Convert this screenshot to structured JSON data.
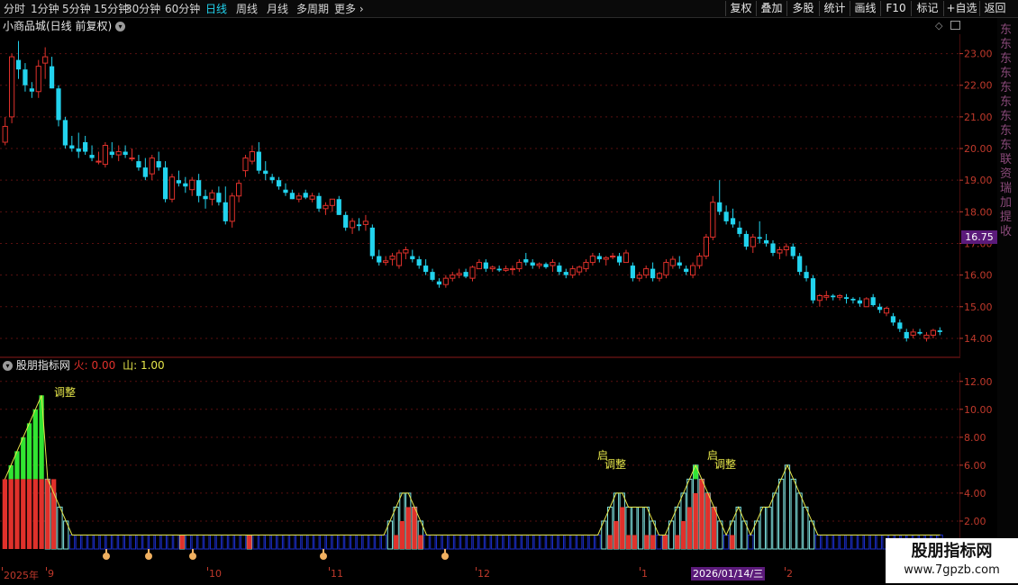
{
  "toolbar": {
    "periods": [
      "分时",
      "1分钟",
      "5分钟",
      "15分钟",
      "30分钟",
      "60分钟",
      "日线",
      "周线",
      "月线",
      "多周期",
      "更多"
    ],
    "active_period": "日线",
    "tools": [
      "复权",
      "叠加",
      "多股",
      "统计",
      "画线",
      "F10",
      "标记",
      "+自选",
      "返回"
    ]
  },
  "main_panel": {
    "title": "小商品城(日线 前复权)",
    "price_ticks": [
      "23.00",
      "22.00",
      "21.00",
      "20.00",
      "19.00",
      "18.00",
      "17.00",
      "16.00",
      "15.00",
      "14.00"
    ],
    "current_price_tag": "16.75"
  },
  "indicator_panel": {
    "name": "股朋指标网",
    "fire_label": "火:",
    "fire_value": "0.00",
    "mountain_label": "山:",
    "mountain_value": "1.00",
    "ticks": [
      "12.00",
      "10.00",
      "8.00",
      "6.00",
      "4.00",
      "2.00"
    ],
    "annotations": {
      "adjust": "调整",
      "start": "启"
    }
  },
  "date_axis": {
    "labels": [
      "2025年",
      "9",
      "10",
      "11",
      "12",
      "1",
      "2"
    ],
    "selected_date": "2026/01/14/三"
  },
  "watermark": {
    "title": "股朋指标网",
    "url": "www.7gpzb.com"
  },
  "side_strip_text": "东东东东东东东东东联资瑞加提收",
  "colors": {
    "up": "#e0312b",
    "down": "#22d3ee",
    "green": "#32e532",
    "accent": "#22d3ee",
    "axis": "#c0392b",
    "blue_bar": "#1c2fd0"
  },
  "chart_data": [
    {
      "type": "candlestick",
      "title": "小商品城(日线 前复权)",
      "ylim": [
        13.6,
        23.5
      ],
      "candles": [
        [
          20.2,
          21.0,
          20.1,
          20.7
        ],
        [
          21.0,
          23.0,
          20.8,
          22.9
        ],
        [
          22.8,
          23.4,
          22.2,
          22.5
        ],
        [
          22.5,
          22.7,
          21.8,
          22.0
        ],
        [
          21.9,
          22.1,
          21.6,
          21.8
        ],
        [
          21.8,
          22.8,
          21.6,
          22.6
        ],
        [
          22.7,
          23.2,
          22.2,
          22.9
        ],
        [
          22.6,
          22.9,
          21.9,
          21.9
        ],
        [
          21.9,
          22.0,
          20.7,
          20.9
        ],
        [
          20.9,
          21.0,
          20.0,
          20.1
        ],
        [
          20.1,
          20.4,
          19.9,
          20.0
        ],
        [
          20.0,
          20.5,
          19.7,
          19.9
        ],
        [
          20.2,
          20.4,
          19.8,
          19.9
        ],
        [
          19.8,
          20.1,
          19.6,
          19.7
        ],
        [
          19.6,
          19.9,
          19.5,
          19.6
        ],
        [
          19.5,
          20.2,
          19.4,
          20.1
        ],
        [
          19.9,
          20.2,
          19.7,
          19.8
        ],
        [
          19.8,
          20.1,
          19.6,
          19.9
        ],
        [
          19.9,
          20.1,
          19.7,
          19.8
        ],
        [
          19.7,
          20.0,
          19.6,
          19.7
        ],
        [
          19.6,
          19.8,
          19.3,
          19.4
        ],
        [
          19.4,
          19.7,
          19.0,
          19.1
        ],
        [
          19.2,
          19.8,
          19.0,
          19.7
        ],
        [
          19.6,
          19.9,
          19.3,
          19.4
        ],
        [
          19.4,
          19.6,
          18.3,
          18.4
        ],
        [
          18.4,
          19.2,
          18.3,
          19.1
        ],
        [
          19.0,
          19.3,
          18.8,
          18.9
        ],
        [
          18.9,
          19.1,
          18.6,
          18.8
        ],
        [
          18.7,
          19.1,
          18.5,
          19.0
        ],
        [
          19.0,
          19.2,
          18.3,
          18.5
        ],
        [
          18.5,
          18.7,
          18.1,
          18.4
        ],
        [
          18.4,
          18.7,
          18.2,
          18.6
        ],
        [
          18.6,
          18.8,
          18.2,
          18.3
        ],
        [
          18.3,
          18.8,
          17.6,
          17.7
        ],
        [
          17.7,
          18.6,
          17.5,
          18.5
        ],
        [
          18.5,
          19.0,
          18.3,
          18.9
        ],
        [
          19.3,
          19.8,
          19.1,
          19.7
        ],
        [
          19.6,
          20.1,
          19.5,
          19.9
        ],
        [
          19.9,
          20.2,
          19.2,
          19.3
        ],
        [
          19.3,
          19.6,
          19.0,
          19.2
        ],
        [
          19.1,
          19.2,
          18.9,
          19.0
        ],
        [
          19.0,
          19.1,
          18.7,
          18.8
        ],
        [
          18.7,
          18.9,
          18.5,
          18.6
        ],
        [
          18.6,
          18.7,
          18.4,
          18.4
        ],
        [
          18.4,
          18.6,
          18.3,
          18.5
        ],
        [
          18.6,
          18.7,
          18.4,
          18.45
        ],
        [
          18.4,
          18.6,
          18.3,
          18.5
        ],
        [
          18.5,
          18.6,
          18.0,
          18.1
        ],
        [
          18.1,
          18.3,
          17.9,
          18.2
        ],
        [
          18.2,
          18.4,
          18.0,
          18.4
        ],
        [
          18.4,
          18.5,
          17.9,
          17.9
        ],
        [
          17.9,
          18.0,
          17.4,
          17.5
        ],
        [
          17.5,
          17.8,
          17.3,
          17.7
        ],
        [
          17.6,
          17.8,
          17.4,
          17.55
        ],
        [
          17.6,
          17.9,
          17.4,
          17.7
        ],
        [
          17.5,
          17.6,
          16.5,
          16.6
        ],
        [
          16.6,
          16.8,
          16.3,
          16.4
        ],
        [
          16.4,
          16.6,
          16.3,
          16.45
        ],
        [
          16.5,
          16.7,
          16.3,
          16.6
        ],
        [
          16.3,
          16.8,
          16.2,
          16.7
        ],
        [
          16.7,
          16.9,
          16.5,
          16.8
        ],
        [
          16.6,
          16.8,
          16.4,
          16.5
        ],
        [
          16.5,
          16.6,
          16.2,
          16.3
        ],
        [
          16.3,
          16.5,
          16.0,
          16.1
        ],
        [
          16.1,
          16.2,
          15.8,
          15.85
        ],
        [
          15.8,
          15.9,
          15.6,
          15.7
        ],
        [
          15.7,
          16.0,
          15.6,
          15.9
        ],
        [
          15.9,
          16.1,
          15.8,
          16.0
        ],
        [
          16.0,
          16.2,
          15.9,
          16.05
        ],
        [
          16.1,
          16.2,
          15.9,
          15.95
        ],
        [
          15.9,
          16.3,
          15.8,
          16.25
        ],
        [
          16.2,
          16.5,
          16.2,
          16.4
        ],
        [
          16.4,
          16.5,
          16.1,
          16.2
        ],
        [
          16.2,
          16.3,
          16.1,
          16.25
        ],
        [
          16.2,
          16.3,
          16.1,
          16.15
        ],
        [
          16.15,
          16.3,
          16.1,
          16.2
        ],
        [
          16.2,
          16.3,
          16.0,
          16.2
        ],
        [
          16.2,
          16.5,
          16.1,
          16.4
        ],
        [
          16.5,
          16.7,
          16.3,
          16.4
        ],
        [
          16.4,
          16.5,
          16.2,
          16.3
        ],
        [
          16.3,
          16.4,
          16.2,
          16.35
        ],
        [
          16.35,
          16.4,
          16.2,
          16.25
        ],
        [
          16.3,
          16.5,
          16.1,
          16.4
        ],
        [
          16.3,
          16.4,
          16.0,
          16.1
        ],
        [
          16.1,
          16.2,
          15.9,
          16.0
        ],
        [
          16.0,
          16.3,
          15.9,
          16.2
        ],
        [
          16.1,
          16.3,
          16.0,
          16.25
        ],
        [
          16.2,
          16.5,
          16.1,
          16.4
        ],
        [
          16.4,
          16.7,
          16.3,
          16.6
        ],
        [
          16.6,
          16.7,
          16.4,
          16.5
        ],
        [
          16.5,
          16.6,
          16.3,
          16.55
        ],
        [
          16.6,
          16.7,
          16.5,
          16.6
        ],
        [
          16.6,
          16.7,
          16.3,
          16.4
        ],
        [
          16.4,
          16.8,
          16.4,
          16.7
        ],
        [
          16.3,
          16.4,
          15.8,
          15.9
        ],
        [
          15.9,
          16.1,
          15.8,
          16.0
        ],
        [
          16.0,
          16.3,
          15.9,
          16.2
        ],
        [
          16.2,
          16.4,
          15.8,
          15.9
        ],
        [
          15.9,
          16.1,
          15.8,
          16.05
        ],
        [
          16.0,
          16.5,
          15.9,
          16.4
        ],
        [
          16.3,
          16.6,
          16.2,
          16.5
        ],
        [
          16.4,
          16.6,
          16.2,
          16.3
        ],
        [
          16.2,
          16.3,
          16.0,
          16.1
        ],
        [
          16.0,
          16.4,
          15.9,
          16.3
        ],
        [
          16.3,
          16.7,
          16.2,
          16.6
        ],
        [
          16.6,
          17.3,
          16.5,
          17.2
        ],
        [
          17.2,
          18.5,
          17.1,
          18.3
        ],
        [
          18.3,
          19.0,
          17.9,
          18.0
        ],
        [
          18.0,
          18.2,
          17.6,
          17.7
        ],
        [
          17.8,
          18.1,
          17.5,
          17.6
        ],
        [
          17.5,
          17.7,
          17.2,
          17.3
        ],
        [
          17.3,
          17.4,
          16.8,
          16.9
        ],
        [
          16.9,
          17.3,
          16.7,
          17.2
        ],
        [
          17.2,
          17.7,
          17.0,
          17.15
        ],
        [
          17.1,
          17.3,
          16.9,
          17.0
        ],
        [
          17.0,
          17.1,
          16.6,
          16.7
        ],
        [
          16.7,
          16.9,
          16.5,
          16.8
        ],
        [
          16.8,
          17.0,
          16.6,
          16.9
        ],
        [
          16.9,
          17.0,
          16.5,
          16.6
        ],
        [
          16.6,
          16.7,
          16.0,
          16.1
        ],
        [
          16.1,
          16.3,
          15.8,
          15.9
        ],
        [
          15.9,
          16.0,
          15.1,
          15.2
        ],
        [
          15.2,
          15.4,
          15.0,
          15.35
        ],
        [
          15.3,
          15.5,
          15.2,
          15.35
        ],
        [
          15.35,
          15.4,
          15.2,
          15.3
        ],
        [
          15.3,
          15.4,
          15.2,
          15.35
        ],
        [
          15.3,
          15.4,
          15.1,
          15.25
        ],
        [
          15.25,
          15.3,
          15.1,
          15.2
        ],
        [
          15.2,
          15.3,
          15.0,
          15.1
        ],
        [
          15.0,
          15.3,
          15.0,
          15.25
        ],
        [
          15.3,
          15.4,
          15.0,
          15.05
        ],
        [
          15.0,
          15.1,
          14.8,
          14.9
        ],
        [
          14.8,
          15.0,
          14.7,
          14.95
        ],
        [
          14.7,
          14.8,
          14.4,
          14.5
        ],
        [
          14.5,
          14.6,
          14.2,
          14.3
        ],
        [
          14.2,
          14.3,
          13.9,
          14.0
        ],
        [
          14.1,
          14.3,
          14.0,
          14.2
        ],
        [
          14.2,
          14.3,
          14.1,
          14.15
        ],
        [
          14.0,
          14.2,
          13.9,
          14.1
        ],
        [
          14.1,
          14.3,
          14.0,
          14.25
        ],
        [
          14.25,
          14.35,
          14.1,
          14.2
        ]
      ]
    },
    {
      "type": "bar",
      "title": "股朋指标网",
      "ylim": [
        0,
        12.5
      ],
      "series": [
        {
          "name": "火",
          "values": [
            5,
            5,
            5,
            5,
            5,
            5,
            5,
            5,
            5,
            0,
            0,
            0,
            0,
            0,
            0,
            0,
            0,
            0,
            0,
            0,
            0,
            0,
            0,
            0,
            0,
            0,
            0,
            0,
            0,
            1,
            0,
            0,
            0,
            0,
            0,
            0,
            0,
            0,
            0,
            0,
            1,
            0,
            0,
            0,
            0,
            0,
            0,
            0,
            0,
            0,
            0,
            0,
            0,
            0,
            0,
            0,
            0,
            0,
            0,
            0,
            0,
            0,
            0,
            0,
            1,
            2,
            3,
            3,
            1,
            0,
            0,
            0,
            0,
            0,
            0,
            0,
            0,
            0,
            0,
            0,
            0,
            0,
            0,
            0,
            0,
            0,
            0,
            0,
            0,
            0,
            0,
            0,
            0,
            0,
            0,
            0,
            0,
            0,
            0,
            1,
            2,
            3,
            1,
            1,
            0,
            1,
            1,
            0,
            1,
            0,
            1,
            2,
            3,
            4,
            5,
            4,
            3,
            0,
            0,
            1,
            0,
            0,
            0,
            0,
            0,
            0,
            0,
            0,
            0,
            0,
            0,
            0,
            0,
            0,
            0,
            0,
            0,
            0,
            0,
            0,
            0,
            0,
            0,
            0,
            0,
            0,
            0,
            0,
            0,
            0,
            0,
            0,
            0,
            0
          ]
        },
        {
          "name": "山",
          "values": [
            5,
            6,
            7,
            8,
            9,
            10,
            11,
            5,
            4,
            3,
            2,
            1,
            1,
            1,
            1,
            1,
            1,
            1,
            1,
            1,
            1,
            1,
            1,
            1,
            1,
            1,
            1,
            1,
            1,
            1,
            1,
            1,
            1,
            1,
            1,
            1,
            1,
            1,
            1,
            1,
            1,
            1,
            1,
            1,
            1,
            1,
            1,
            1,
            1,
            1,
            1,
            1,
            1,
            1,
            1,
            1,
            1,
            1,
            1,
            1,
            1,
            1,
            1,
            2,
            3,
            4,
            4,
            3,
            2,
            1,
            1,
            1,
            1,
            1,
            1,
            1,
            1,
            1,
            1,
            1,
            1,
            1,
            1,
            1,
            1,
            1,
            1,
            1,
            1,
            1,
            1,
            1,
            1,
            1,
            1,
            1,
            1,
            1,
            2,
            3,
            4,
            4,
            3,
            3,
            3,
            3,
            2,
            1,
            1,
            2,
            3,
            4,
            5,
            6,
            5,
            4,
            3,
            2,
            1,
            2,
            3,
            2,
            1,
            2,
            3,
            3,
            4,
            5,
            6,
            5,
            4,
            3,
            2,
            1,
            1,
            1,
            1,
            1,
            1,
            1,
            1,
            1,
            1,
            1,
            1,
            1,
            1,
            1,
            1,
            1,
            1,
            1,
            1,
            1
          ]
        }
      ]
    }
  ]
}
